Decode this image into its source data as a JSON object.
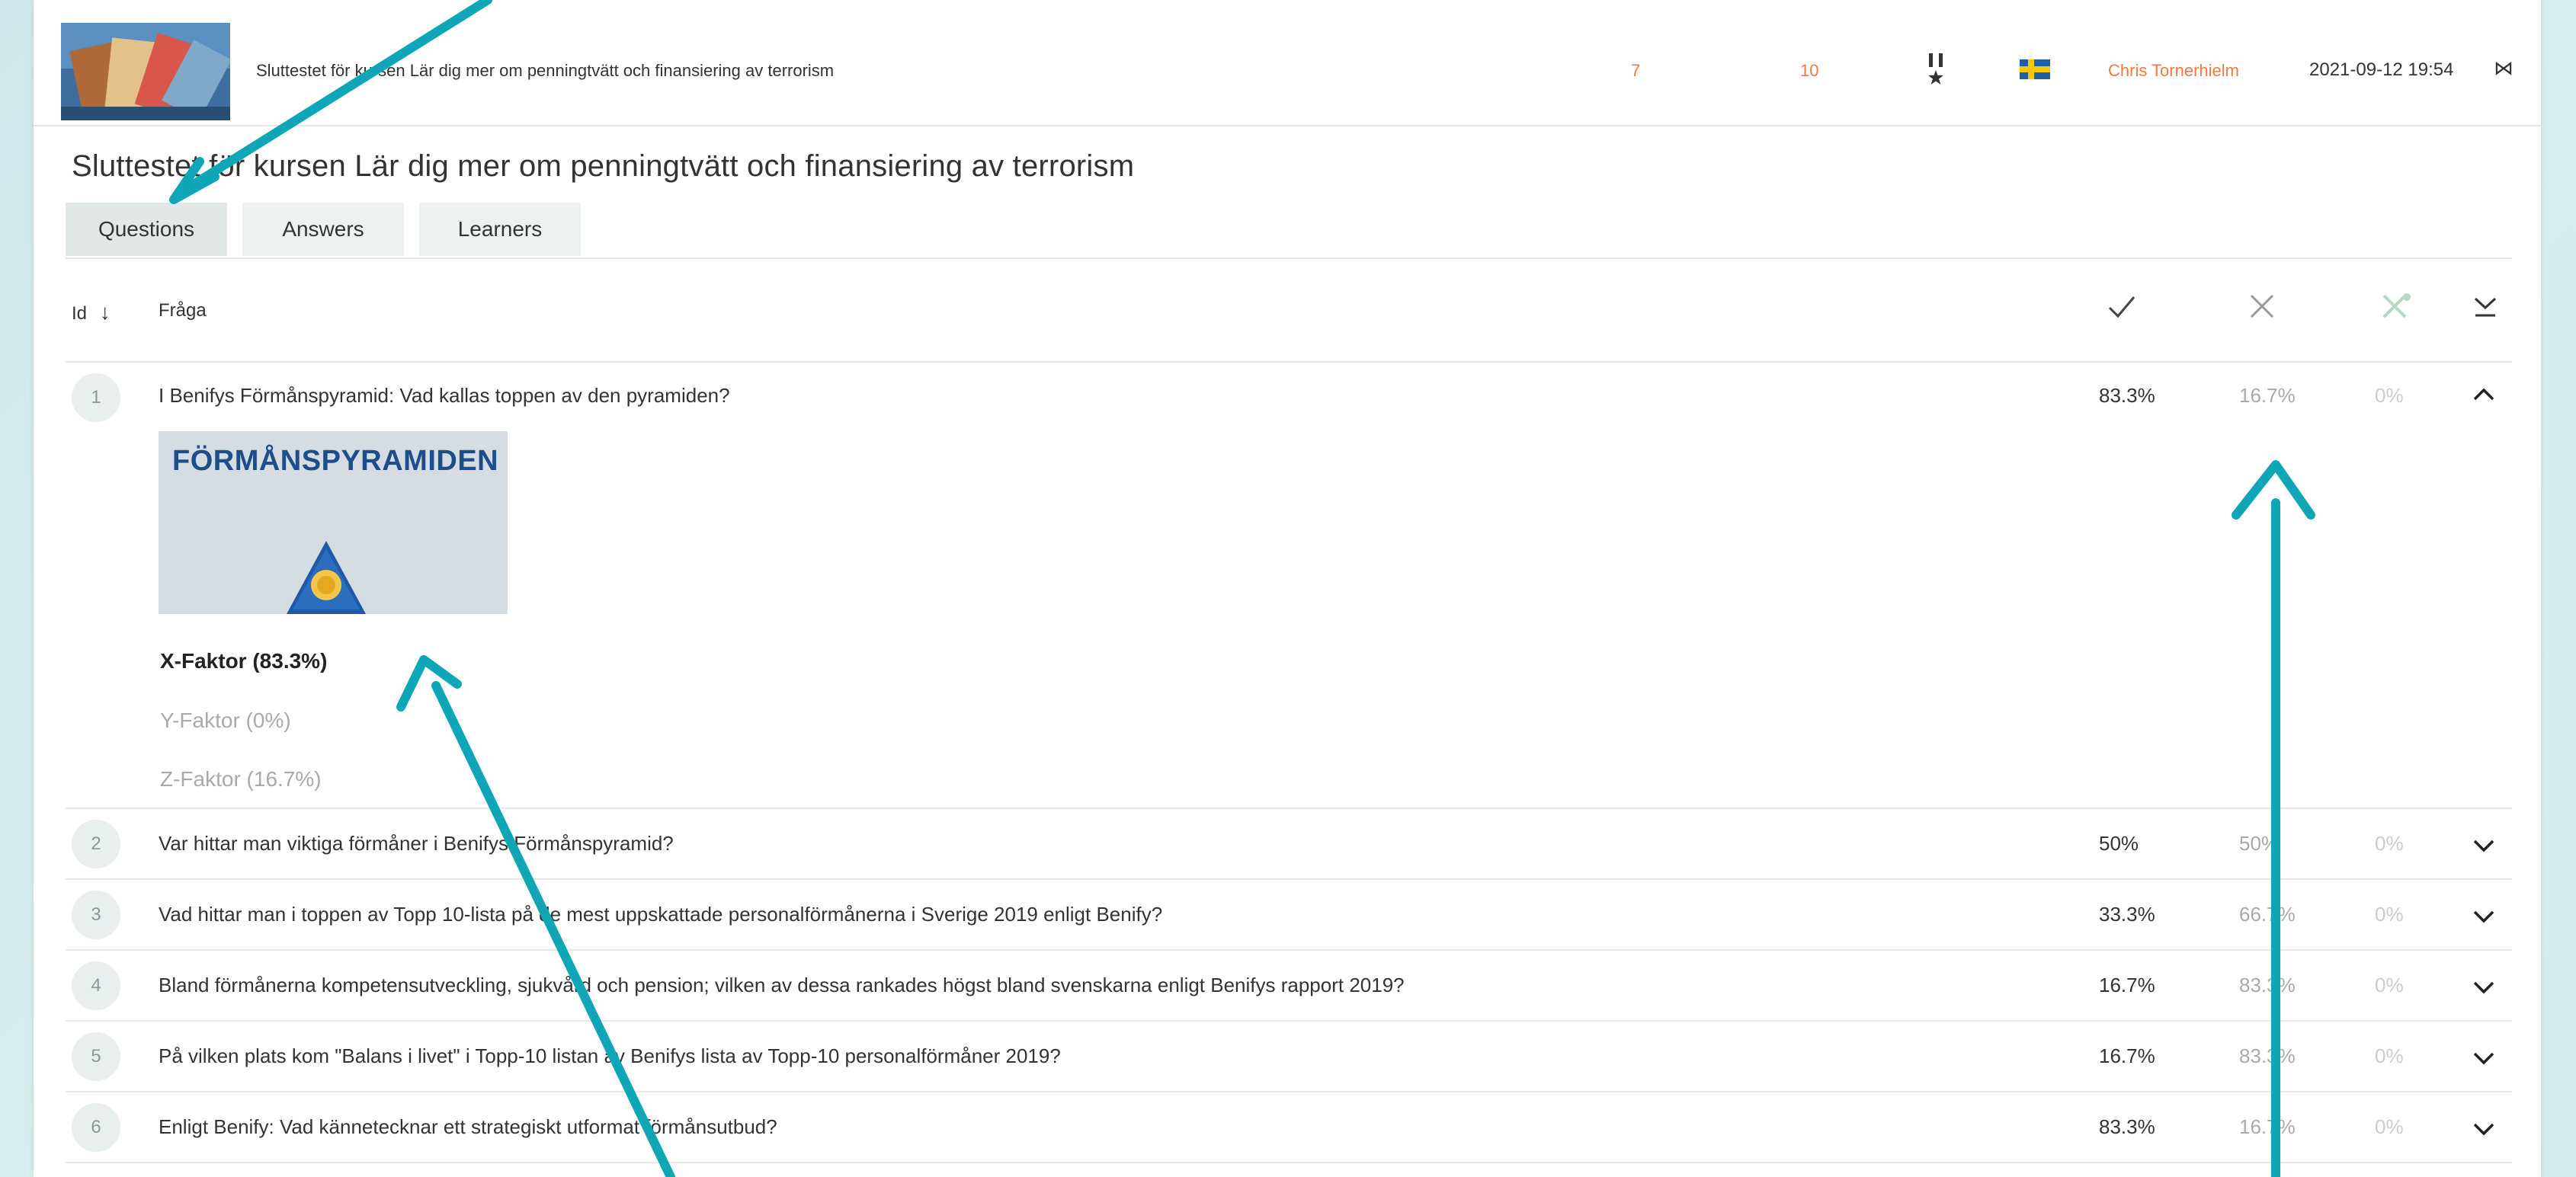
{
  "header": {
    "course_name": "Sluttestet för kursen Lär dig mer om penningtvätt och finansiering av terrorism",
    "count_a": "7",
    "count_b": "10",
    "author": "Chris Tornerhielm",
    "date": "2021-09-12 19:54",
    "collapse_glyph": "⋈"
  },
  "title": "Sluttestet för kursen Lär dig mer om penningtvätt och finansiering av terrorism",
  "tabs": [
    {
      "label": "Questions",
      "active": true
    },
    {
      "label": "Answers",
      "active": false
    },
    {
      "label": "Learners",
      "active": false
    }
  ],
  "columns": {
    "id": "Id",
    "sort_glyph": "↓",
    "question": "Fråga"
  },
  "question_image_title": "FÖRMÅNSPYRAMIDEN",
  "questions": [
    {
      "id": "1",
      "text": "I Benifys Förmånspyramid: Vad kallas toppen av den pyramiden?",
      "correct": "83.3%",
      "wrong": "16.7%",
      "skipped": "0%",
      "expanded": true,
      "answers": [
        {
          "label": "X-Faktor  (83.3%)",
          "correct": true
        },
        {
          "label": "Y-Faktor  (0%)",
          "correct": false
        },
        {
          "label": "Z-Faktor  (16.7%)",
          "correct": false
        }
      ]
    },
    {
      "id": "2",
      "text": "Var hittar man viktiga förmåner i Benifys Förmånspyramid?",
      "correct": "50%",
      "wrong": "50%",
      "skipped": "0%",
      "expanded": false
    },
    {
      "id": "3",
      "text": "Vad hittar man i toppen av Topp 10-lista på de mest uppskattade personalförmånerna i Sverige 2019 enligt Benify?",
      "correct": "33.3%",
      "wrong": "66.7%",
      "skipped": "0%",
      "expanded": false
    },
    {
      "id": "4",
      "text": "Bland förmånerna kompetensutveckling, sjukvård och pension; vilken av dessa rankades högst bland svenskarna enligt Benifys rapport 2019?",
      "correct": "16.7%",
      "wrong": "83.3%",
      "skipped": "0%",
      "expanded": false
    },
    {
      "id": "5",
      "text": "På vilken plats kom \"Balans i livet\" i Topp-10 listan av Benifys lista av Topp-10 personalförmåner 2019?",
      "correct": "16.7%",
      "wrong": "83.3%",
      "skipped": "0%",
      "expanded": false
    },
    {
      "id": "6",
      "text": "Enligt Benify: Vad kännetecknar ett strategiskt utformat förmånsutbud?",
      "correct": "83.3%",
      "wrong": "16.7%",
      "skipped": "0%",
      "expanded": false
    }
  ],
  "colors": {
    "accent": "#f07a40",
    "arrow": "#0fa6b8",
    "flag_blue": "#1e5fa7",
    "flag_yellow": "#f5c800"
  },
  "icons": [
    "medal-icon",
    "sweden-flag-icon",
    "check-icon",
    "cross-icon",
    "skip-icon",
    "expand-all-icon",
    "chevron-up-icon",
    "chevron-down-icon"
  ]
}
